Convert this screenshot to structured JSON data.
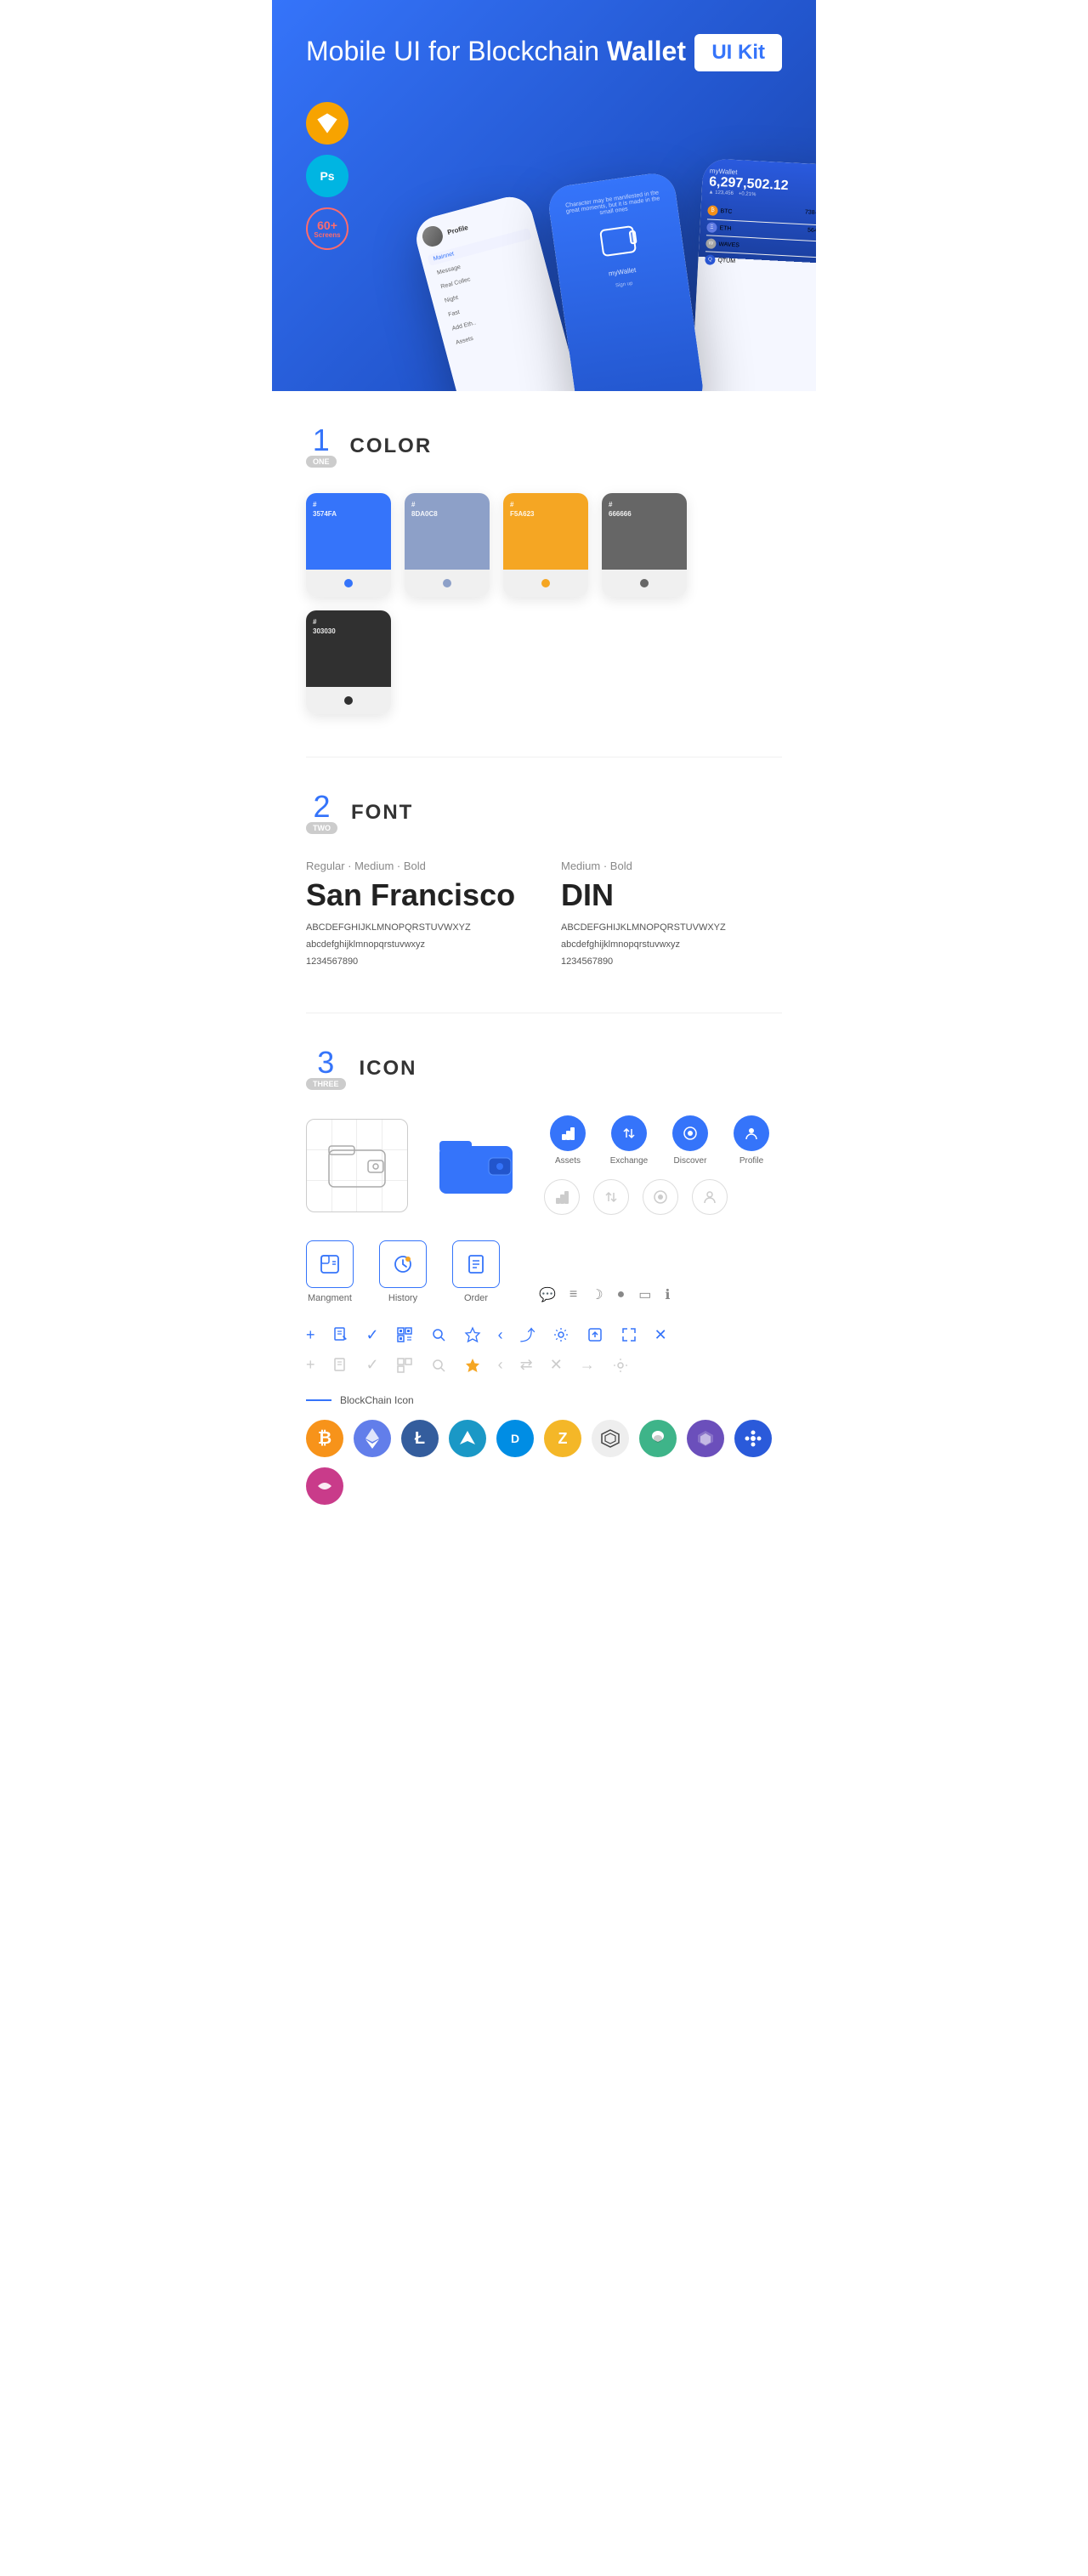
{
  "hero": {
    "title_normal": "Mobile UI for Blockchain ",
    "title_bold": "Wallet",
    "badge": "UI Kit",
    "badges": [
      {
        "id": "sketch",
        "label": "Sk",
        "bg": "#F7A300"
      },
      {
        "id": "ps",
        "label": "Ps",
        "bg": "#00B5E2"
      },
      {
        "id": "screens",
        "line1": "60+",
        "line2": "Screens",
        "bg": "transparent"
      }
    ]
  },
  "sections": {
    "color": {
      "number": "1",
      "word": "ONE",
      "title": "COLOR",
      "swatches": [
        {
          "id": "blue",
          "hex": "#3574FA",
          "code": "#\n3574FA",
          "dot": "#3574FA"
        },
        {
          "id": "gray-blue",
          "hex": "#8DA0C8",
          "code": "#\n8DA0C8",
          "dot": "#8DA0C8"
        },
        {
          "id": "orange",
          "hex": "#F5A623",
          "code": "#\nF5A623",
          "dot": "#F5A623"
        },
        {
          "id": "gray",
          "hex": "#666666",
          "code": "#\n666666",
          "dot": "#666666"
        },
        {
          "id": "dark",
          "hex": "#303030",
          "code": "#\n303030",
          "dot": "#303030"
        }
      ]
    },
    "font": {
      "number": "2",
      "word": "TWO",
      "title": "FONT",
      "left": {
        "style": "Regular · Medium · Bold",
        "name": "San Francisco",
        "uppercase": "ABCDEFGHIJKLMNOPQRSTUVWXYZ",
        "lowercase": "abcdefghijklmnopqrstuvwxyz",
        "numbers": "1234567890"
      },
      "right": {
        "style": "Medium · Bold",
        "name": "DIN",
        "uppercase": "ABCDEFGHIJKLMNOPQRSTUVWXYZ",
        "lowercase": "abcdefghijklmnopqrstuvwxyz",
        "numbers": "1234567890"
      }
    },
    "icon": {
      "number": "3",
      "word": "THREE",
      "title": "ICON",
      "nav_icons": [
        {
          "label": "Assets",
          "color": "#3574FA"
        },
        {
          "label": "Exchange",
          "color": "#3574FA"
        },
        {
          "label": "Discover",
          "color": "#3574FA"
        },
        {
          "label": "Profile",
          "color": "#3574FA"
        }
      ],
      "app_icons": [
        {
          "label": "Mangment"
        },
        {
          "label": "History"
        },
        {
          "label": "Order"
        }
      ],
      "blockchain_label": "BlockChain Icon",
      "crypto_coins": [
        {
          "symbol": "₿",
          "color": "#F7931A",
          "bg": "#fff3e0",
          "name": "Bitcoin"
        },
        {
          "symbol": "Ξ",
          "color": "#627EEA",
          "bg": "#e8eeff",
          "name": "Ethereum"
        },
        {
          "symbol": "Ł",
          "color": "#345D9D",
          "bg": "#e0e8f8",
          "name": "Litecoin"
        },
        {
          "symbol": "◆",
          "color": "#1A98C6",
          "bg": "#e0f4ff",
          "name": "Nxt"
        },
        {
          "symbol": "D",
          "color": "#008DE4",
          "bg": "#e0f0ff",
          "name": "Dash"
        },
        {
          "symbol": "Z",
          "color": "#F4B728",
          "bg": "#fff8e0",
          "name": "Zcash"
        },
        {
          "symbol": "⬡",
          "color": "#444",
          "bg": "#f0f0f0",
          "name": "Grid"
        },
        {
          "symbol": "⬡",
          "color": "#3EB489",
          "bg": "#e0f5ee",
          "name": "Steem"
        },
        {
          "symbol": "◈",
          "color": "#6B4FBB",
          "bg": "#efe8ff",
          "name": "Augur"
        },
        {
          "symbol": "∞",
          "color": "#2A5ADA",
          "bg": "#e0e8ff",
          "name": "Polkadot"
        },
        {
          "symbol": "~",
          "color": "#C93B8A",
          "bg": "#ffe0f0",
          "name": "Unknown"
        }
      ]
    }
  }
}
